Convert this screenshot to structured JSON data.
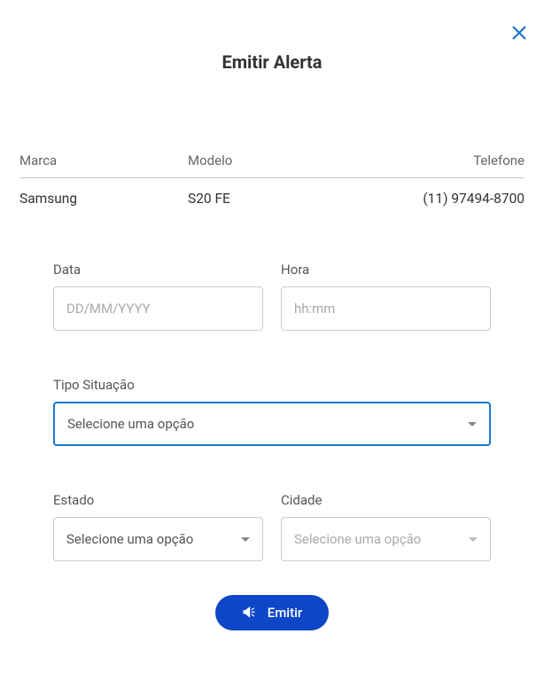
{
  "title": "Emitir Alerta",
  "device": {
    "headers": {
      "marca": "Marca",
      "modelo": "Modelo",
      "telefone": "Telefone"
    },
    "row": {
      "marca": "Samsung",
      "modelo": "S20 FE",
      "telefone": "(11) 97494-8700"
    }
  },
  "form": {
    "data": {
      "label": "Data",
      "placeholder": "DD/MM/YYYY"
    },
    "hora": {
      "label": "Hora",
      "placeholder": "hh:mm"
    },
    "situacao": {
      "label": "Tipo Situação",
      "placeholder": "Selecione uma opção"
    },
    "estado": {
      "label": "Estado",
      "placeholder": "Selecione uma opção"
    },
    "cidade": {
      "label": "Cidade",
      "placeholder": "Selecione uma opção"
    }
  },
  "submit": {
    "label": "Emitir"
  }
}
